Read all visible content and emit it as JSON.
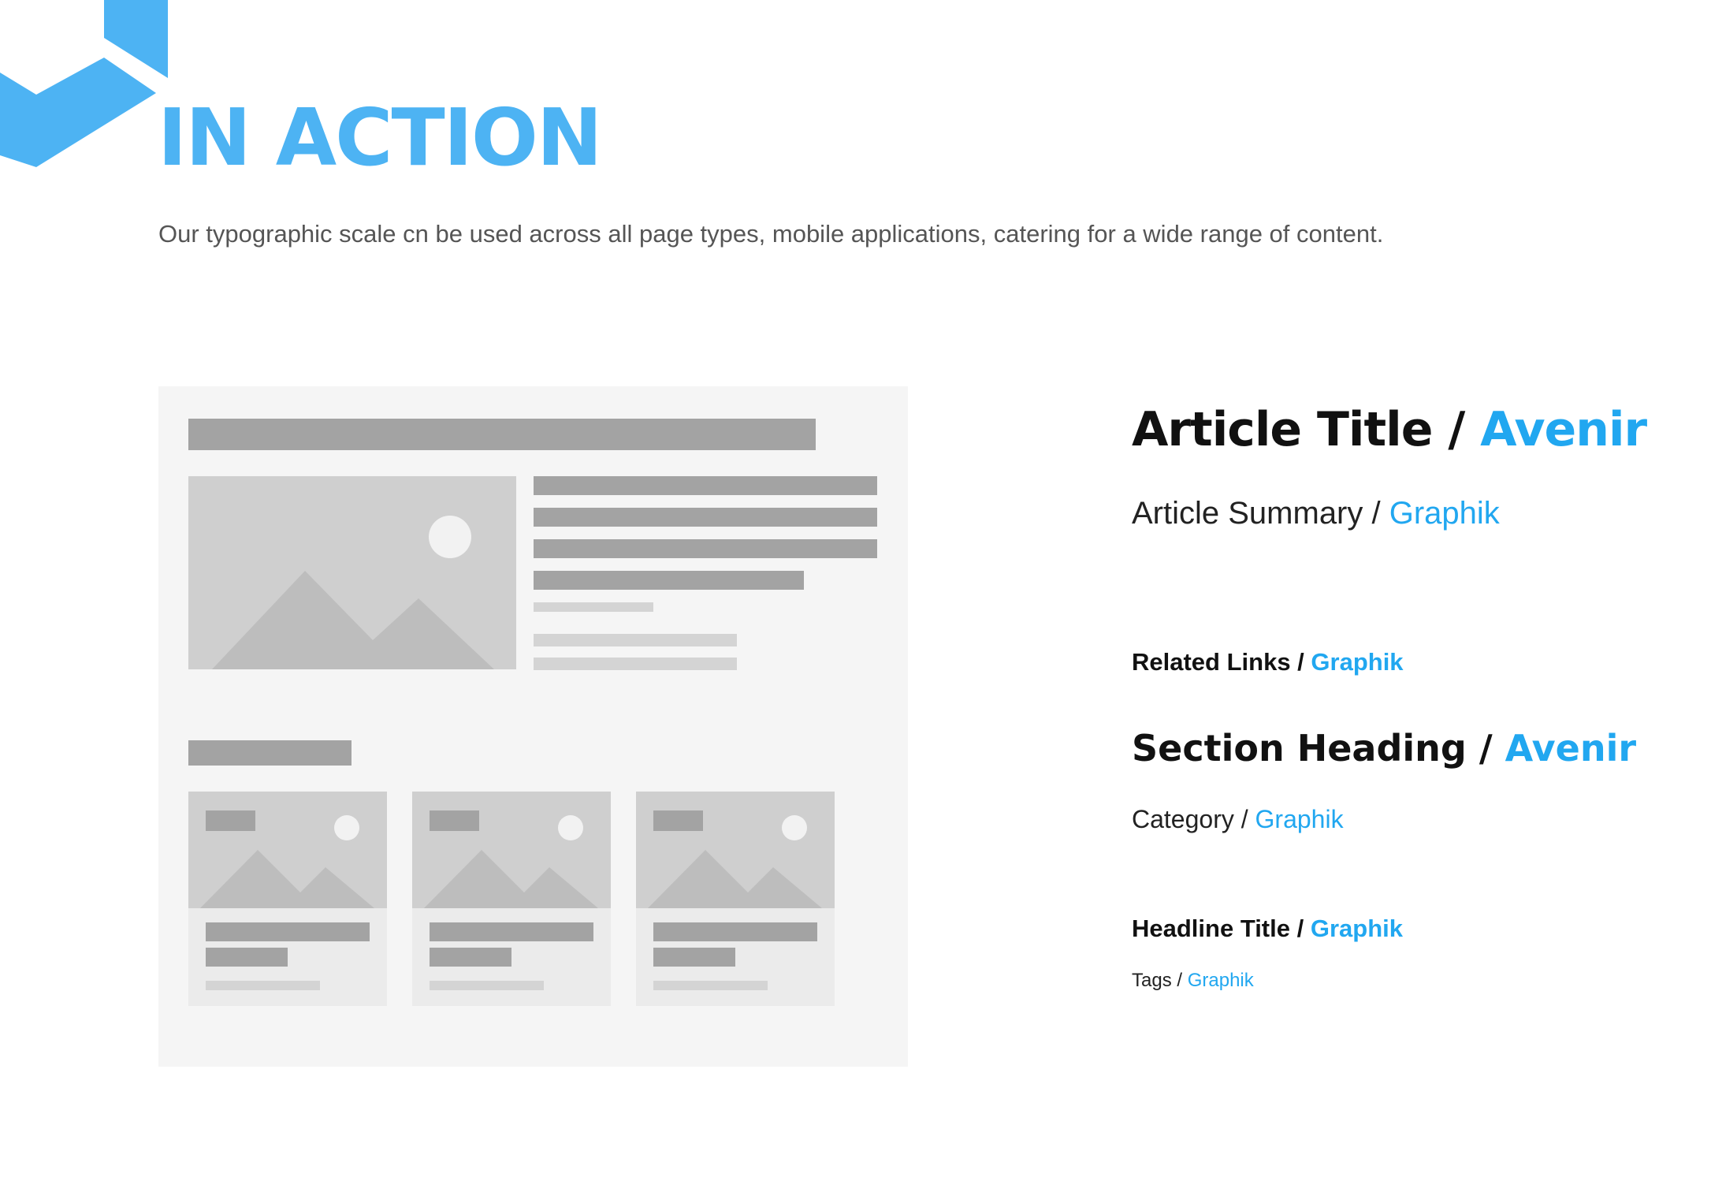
{
  "brand": {
    "accent_color": "#4db3f3",
    "logo_icon": "chevron-cube-logo"
  },
  "header": {
    "title": "IN ACTION",
    "intro": "Our typographic scale cn be used  across all page types, mobile applications, catering for a wide range of content."
  },
  "wireframe": {
    "description_icon": "page-layout-wireframe",
    "image_icon": "image-placeholder-icon"
  },
  "specimens": {
    "separator": " / ",
    "accent_color": "#21a7f0",
    "items": [
      {
        "label": "Article Title",
        "font": "Avenir"
      },
      {
        "label": "Article Summary",
        "font": "Graphik"
      },
      {
        "label": "Related Links",
        "font": "Graphik"
      },
      {
        "label": "Section Heading",
        "font": "Avenir"
      },
      {
        "label": "Category",
        "font": "Graphik"
      },
      {
        "label": "Headline Title",
        "font": "Graphik"
      },
      {
        "label": "Tags",
        "font": "Graphik"
      }
    ]
  }
}
